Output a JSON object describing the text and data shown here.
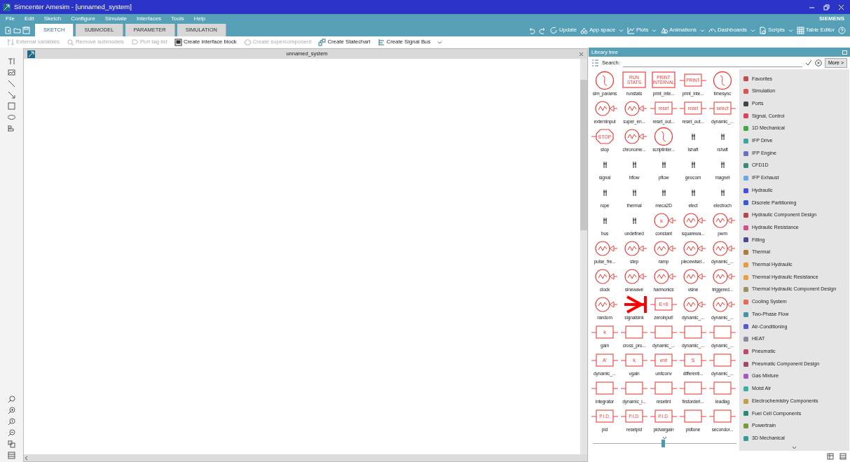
{
  "window": {
    "title": "Simcenter Amesim - [unnamed_system]",
    "brand": "SIEMENS"
  },
  "menu": [
    "File",
    "Edit",
    "Sketch",
    "Configure",
    "Simulate",
    "Interfaces",
    "Tools",
    "Help"
  ],
  "tabs": [
    {
      "label": "SKETCH",
      "selected": true
    },
    {
      "label": "SUBMODEL",
      "selected": false
    },
    {
      "label": "PARAMETER",
      "selected": false
    },
    {
      "label": "SIMULATION",
      "selected": false
    }
  ],
  "right_toolbar": [
    {
      "label": "Update",
      "dropdown": false
    },
    {
      "label": "App space",
      "dropdown": true
    },
    {
      "label": "Plots",
      "dropdown": true
    },
    {
      "label": "Animations",
      "dropdown": true
    },
    {
      "label": "Dashboards",
      "dropdown": true
    },
    {
      "label": "Scripts",
      "dropdown": true
    },
    {
      "label": "Table Editor",
      "dropdown": false
    }
  ],
  "commands": [
    {
      "label": "External variables",
      "disabled": true
    },
    {
      "label": "Remove submodels",
      "disabled": true
    },
    {
      "label": "Port tag list",
      "disabled": true
    },
    {
      "label": "Create interface block",
      "disabled": false
    },
    {
      "label": "Create supercomponent",
      "disabled": true
    },
    {
      "label": "Create Statechart",
      "disabled": false
    },
    {
      "label": "Create Signal Bus",
      "disabled": false
    }
  ],
  "canvas": {
    "tab_title": "unnamed_system"
  },
  "library": {
    "title": "Library tree",
    "search_label": "Search:",
    "more_button": "More >",
    "items": [
      {
        "label": "sim_params",
        "kind": "bigcircle"
      },
      {
        "label": "runstats",
        "kind": "plate",
        "glyph": "RUN STATS"
      },
      {
        "label": "print_inte...",
        "kind": "plate",
        "glyph": "PRINT INTERVAL"
      },
      {
        "label": "print_inte...",
        "kind": "box",
        "glyph": "PRINT"
      },
      {
        "label": "timesync",
        "kind": "bigcircle"
      },
      {
        "label": "externinput",
        "kind": "circle"
      },
      {
        "label": "super_en...",
        "kind": "circle"
      },
      {
        "label": "reset_out...",
        "kind": "box",
        "glyph": "reset"
      },
      {
        "label": "reset_out...",
        "kind": "box",
        "glyph": "reset"
      },
      {
        "label": "dynamic_...",
        "kind": "box",
        "glyph": "select"
      },
      {
        "label": "stop",
        "kind": "stop",
        "glyph": "STOP"
      },
      {
        "label": "chronome...",
        "kind": "circle"
      },
      {
        "label": "scriptinter...",
        "kind": "bigcircle"
      },
      {
        "label": "lshaft",
        "kind": "port"
      },
      {
        "label": "rshaft",
        "kind": "port"
      },
      {
        "label": "signal",
        "kind": "port"
      },
      {
        "label": "hflow",
        "kind": "port"
      },
      {
        "label": "pflow",
        "kind": "port"
      },
      {
        "label": "geocom",
        "kind": "port"
      },
      {
        "label": "magnet",
        "kind": "port"
      },
      {
        "label": "rope",
        "kind": "port"
      },
      {
        "label": "thermal",
        "kind": "port"
      },
      {
        "label": "meca2D",
        "kind": "port"
      },
      {
        "label": "elect",
        "kind": "port"
      },
      {
        "label": "electroch",
        "kind": "port"
      },
      {
        "label": "bus",
        "kind": "port"
      },
      {
        "label": "undefined",
        "kind": "port"
      },
      {
        "label": "constant",
        "kind": "circle",
        "glyph": "k"
      },
      {
        "label": "squarewa...",
        "kind": "circle"
      },
      {
        "label": "pwm",
        "kind": "circle"
      },
      {
        "label": "pulse_fre...",
        "kind": "circle"
      },
      {
        "label": "step",
        "kind": "circle"
      },
      {
        "label": "ramp",
        "kind": "circle"
      },
      {
        "label": "piecewisel...",
        "kind": "circle"
      },
      {
        "label": "dynamic_...",
        "kind": "circle"
      },
      {
        "label": "clock",
        "kind": "circle"
      },
      {
        "label": "sinewave",
        "kind": "circle"
      },
      {
        "label": "harmonics",
        "kind": "circle"
      },
      {
        "label": "vsine",
        "kind": "circle"
      },
      {
        "label": "triggered...",
        "kind": "circle"
      },
      {
        "label": "random",
        "kind": "circle"
      },
      {
        "label": "signalsink",
        "kind": "sink"
      },
      {
        "label": "zeroinput!",
        "kind": "box",
        "glyph": "E=0"
      },
      {
        "label": "dynamic_...",
        "kind": "circle"
      },
      {
        "label": "dynamic_...",
        "kind": "circle"
      },
      {
        "label": "gain",
        "kind": "box",
        "glyph": "k"
      },
      {
        "label": "cross_pro...",
        "kind": "box"
      },
      {
        "label": "dynamic_...",
        "kind": "box"
      },
      {
        "label": "dynamic_...",
        "kind": "box"
      },
      {
        "label": "dynamic_...",
        "kind": "box"
      },
      {
        "label": "dynamic_...",
        "kind": "box",
        "glyph": "A'"
      },
      {
        "label": "vgain",
        "kind": "box",
        "glyph": "k"
      },
      {
        "label": "unitconv",
        "kind": "box",
        "glyph": "unit"
      },
      {
        "label": "differenti...",
        "kind": "box",
        "glyph": "S"
      },
      {
        "label": "dynamic_...",
        "kind": "box"
      },
      {
        "label": "integrator",
        "kind": "box"
      },
      {
        "label": "dynamic_i...",
        "kind": "box"
      },
      {
        "label": "resetint",
        "kind": "box"
      },
      {
        "label": "firstorderl...",
        "kind": "box"
      },
      {
        "label": "leadlag",
        "kind": "box"
      },
      {
        "label": "pid",
        "kind": "box",
        "glyph": "P.I.D."
      },
      {
        "label": "resetpid",
        "kind": "box",
        "glyph": "P.I.D."
      },
      {
        "label": "pidvargain",
        "kind": "box",
        "glyph": "P.I.D."
      },
      {
        "label": "pidtune",
        "kind": "box"
      },
      {
        "label": "secondor...",
        "kind": "box"
      }
    ],
    "size_slider": {
      "level": 0.49
    },
    "categories": [
      {
        "label": "Favorites",
        "color": "#c0504d"
      },
      {
        "label": "Simulation",
        "color": "#d9534f"
      },
      {
        "label": "Ports",
        "color": "#444444"
      },
      {
        "label": "Signal, Control",
        "color": "#e0405a"
      },
      {
        "label": "1D Mechanical",
        "color": "#3fa84a"
      },
      {
        "label": "IFP Drive",
        "color": "#3aa6a0"
      },
      {
        "label": "IFP Engine",
        "color": "#6a6fc0"
      },
      {
        "label": "CFD1D",
        "color": "#3a8a7a"
      },
      {
        "label": "IFP Exhaust",
        "color": "#6aa8e0"
      },
      {
        "label": "Hydraulic",
        "color": "#4a4ae0"
      },
      {
        "label": "Discrete Partitioning",
        "color": "#3a5ad0"
      },
      {
        "label": "Hydraulic Component Design",
        "color": "#b04a4a"
      },
      {
        "label": "Hydraulic Resistance",
        "color": "#d0508a"
      },
      {
        "label": "Filling",
        "color": "#4a4a90"
      },
      {
        "label": "Thermal",
        "color": "#b07a3a"
      },
      {
        "label": "Thermal Hydraulic",
        "color": "#e89a40"
      },
      {
        "label": "Thermal Hydraulic Resistance",
        "color": "#e8a040"
      },
      {
        "label": "Thermal Hydraulic Component Design",
        "color": "#a09060"
      },
      {
        "label": "Cooling System",
        "color": "#e86a50"
      },
      {
        "label": "Two-Phase Flow",
        "color": "#4a90a8"
      },
      {
        "label": "Air-Conditioning",
        "color": "#5a5ad0"
      },
      {
        "label": "HEAT",
        "color": "#8a8aa0"
      },
      {
        "label": "Pneumatic",
        "color": "#c04a6a"
      },
      {
        "label": "Pneumatic Component Design",
        "color": "#a04a6a"
      },
      {
        "label": "Gas Mixture",
        "color": "#a05ac0"
      },
      {
        "label": "Moist Air",
        "color": "#3ab0a0"
      },
      {
        "label": "Electrochemistry Components",
        "color": "#c0a040"
      },
      {
        "label": "Fuel Cell Components",
        "color": "#2a8a7a"
      },
      {
        "label": "Powertrain",
        "color": "#7a9a3a"
      },
      {
        "label": "3D Mechanical",
        "color": "#3a9a9a"
      }
    ]
  }
}
